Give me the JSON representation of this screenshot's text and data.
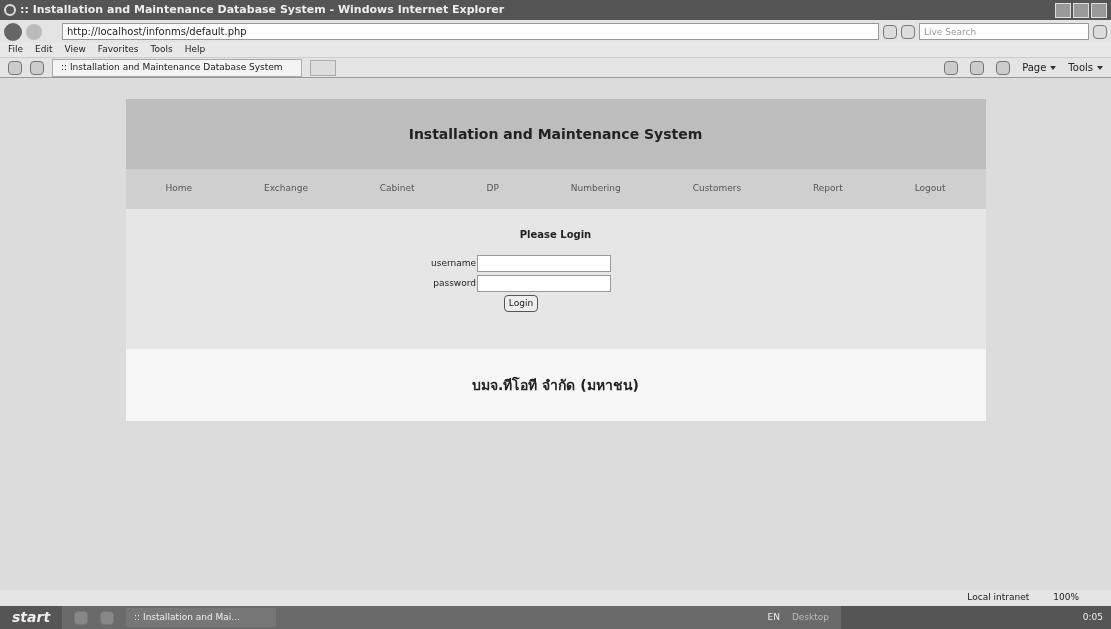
{
  "window": {
    "title": ":: Installation and Maintenance Database System - Windows Internet Explorer"
  },
  "address_bar": {
    "url": "http://localhost/infonms/default.php",
    "search_placeholder": "Live Search"
  },
  "menu_bar": [
    "File",
    "Edit",
    "View",
    "Favorites",
    "Tools",
    "Help"
  ],
  "tabs": [
    {
      "label": ":: Installation and Maintenance Database System",
      "selected": true
    }
  ],
  "command_bar": [
    "Page",
    "Tools"
  ],
  "page": {
    "header": "Installation and Maintenance System",
    "nav": [
      "Home",
      "Exchange",
      "Cabinet",
      "DP",
      "Numbering",
      "Customers",
      "Report",
      "Logout"
    ],
    "login": {
      "title": "Please Login",
      "fields": [
        {
          "label": "username"
        },
        {
          "label": "password"
        }
      ],
      "button": "Login"
    },
    "footer": "บมจ.ทีโอที จำกัด (มหาชน)"
  },
  "status_bar": {
    "zone": "Local intranet",
    "zoom": "100%"
  },
  "taskbar": {
    "start": "start",
    "task": ":: Installation and Mai...",
    "language": "EN",
    "toolbar": "Desktop",
    "clock": "0:05"
  }
}
